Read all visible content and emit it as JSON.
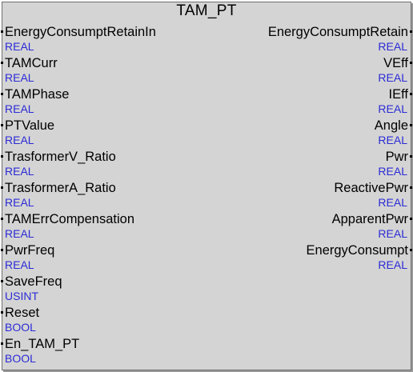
{
  "block": {
    "title": "TAM_PT"
  },
  "inputs": [
    {
      "name": "EnergyConsumptRetainIn",
      "type": "REAL"
    },
    {
      "name": "TAMCurr",
      "type": "REAL"
    },
    {
      "name": "TAMPhase",
      "type": "REAL"
    },
    {
      "name": "PTValue",
      "type": "REAL"
    },
    {
      "name": "TrasformerV_Ratio",
      "type": "REAL"
    },
    {
      "name": "TrasformerA_Ratio",
      "type": "REAL"
    },
    {
      "name": "TAMErrCompensation",
      "type": "REAL"
    },
    {
      "name": "PwrFreq",
      "type": "REAL"
    },
    {
      "name": "SaveFreq",
      "type": "USINT"
    },
    {
      "name": "Reset",
      "type": "BOOL"
    },
    {
      "name": "En_TAM_PT",
      "type": "BOOL"
    }
  ],
  "outputs": [
    {
      "name": "EnergyConsumptRetain",
      "type": "REAL"
    },
    {
      "name": "VEff",
      "type": "REAL"
    },
    {
      "name": "IEff",
      "type": "REAL"
    },
    {
      "name": "Angle",
      "type": "REAL"
    },
    {
      "name": "Pwr",
      "type": "REAL"
    },
    {
      "name": "ReactivePwr",
      "type": "REAL"
    },
    {
      "name": "ApparentPwr",
      "type": "REAL"
    },
    {
      "name": "EnergyConsumpt",
      "type": "REAL"
    }
  ]
}
